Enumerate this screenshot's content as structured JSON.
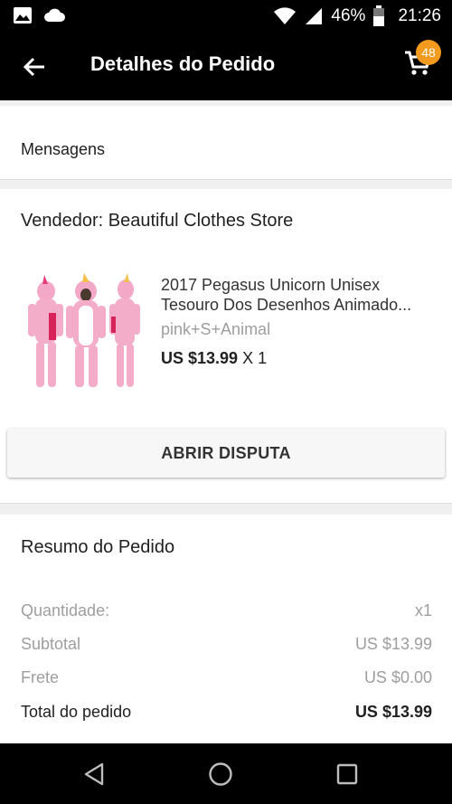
{
  "status_bar": {
    "battery": "46%",
    "time": "21:26"
  },
  "app_bar": {
    "title": "Detalhes do Pedido",
    "cart_count": "48"
  },
  "messages": {
    "label": "Mensagens"
  },
  "order": {
    "seller": "Vendedor: Beautiful Clothes Store",
    "product": {
      "title_line1": "2017 Pegasus Unicorn Unisex",
      "title_line2": "Tesouro Dos Desenhos Animado...",
      "variant": "pink+S+Animal",
      "price": "US $13.99",
      "quantity": "X 1"
    },
    "dispute_button": "ABRIR DISPUTA"
  },
  "summary": {
    "title": "Resumo do Pedido",
    "rows": [
      {
        "label": "Quantidade:",
        "value": "x1"
      },
      {
        "label": "Subtotal",
        "value": "US $13.99"
      },
      {
        "label": "Frete",
        "value": "US $0.00"
      }
    ],
    "total_label": "Total do pedido",
    "total_value": "US $13.99"
  },
  "colors": {
    "badge": "#f29b1e",
    "bar": "#000000"
  },
  "icons": [
    "image-icon",
    "cloud-icon",
    "wifi-icon",
    "signal-icon",
    "battery-icon",
    "back-arrow-icon",
    "cart-icon",
    "nav-back-icon",
    "nav-home-icon",
    "nav-recents-icon"
  ]
}
